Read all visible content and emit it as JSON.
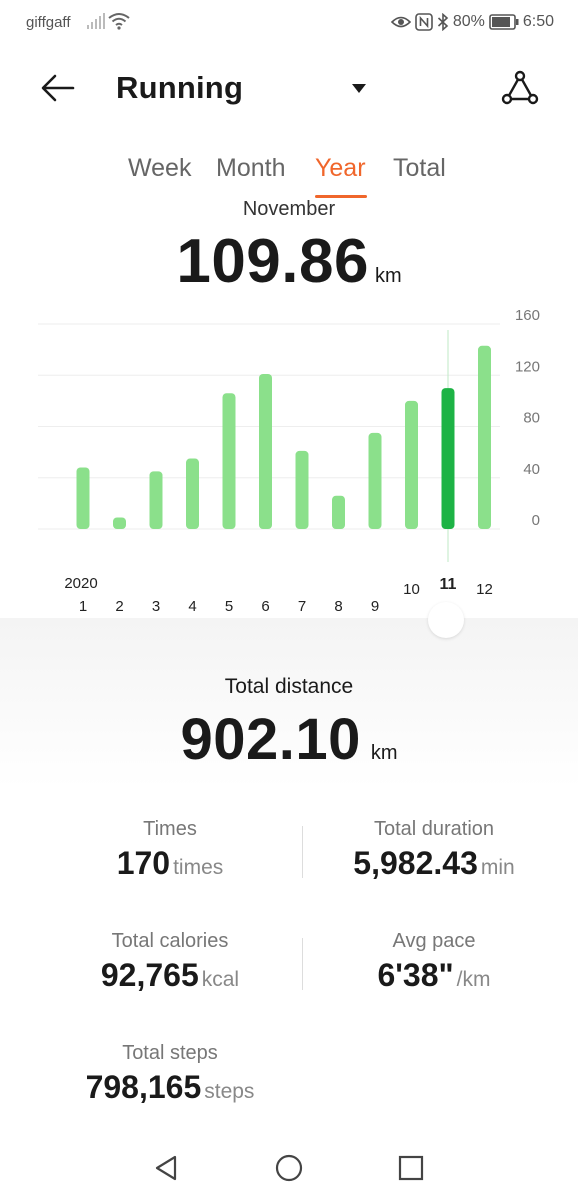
{
  "status_bar": {
    "carrier": "giffgaff",
    "battery": "80%",
    "time": "6:50",
    "icons": [
      "signal-icon",
      "wifi-icon",
      "eye-icon",
      "nfc-icon",
      "bluetooth-icon",
      "battery-icon"
    ]
  },
  "header": {
    "title": "Running",
    "back_icon": "back-arrow-icon",
    "dropdown_icon": "caret-down-icon",
    "action_icon": "route-icon"
  },
  "tabs": [
    {
      "label": "Week",
      "active": false
    },
    {
      "label": "Month",
      "active": false
    },
    {
      "label": "Year",
      "active": true
    },
    {
      "label": "Total",
      "active": false
    }
  ],
  "selected": {
    "month_label": "November",
    "value": "109.86",
    "unit": "km"
  },
  "chart_data": {
    "type": "bar",
    "categories": [
      "1",
      "2",
      "3",
      "4",
      "5",
      "6",
      "7",
      "8",
      "9",
      "10",
      "11",
      "12"
    ],
    "year_label": "2020",
    "values": [
      48,
      9,
      45,
      55,
      106,
      121,
      61,
      26,
      75,
      100,
      110,
      143
    ],
    "y_ticks": [
      "160",
      "120",
      "80",
      "40",
      "0"
    ],
    "ylim": [
      0,
      160
    ],
    "selected_index": 10,
    "colors": {
      "bar": "#8be08b",
      "selected_bar": "#1db345",
      "grid": "#eeeeee",
      "axis_text": "#777777",
      "label_text": "#222222"
    },
    "grid": true
  },
  "summary": {
    "total_label": "Total distance",
    "total_value": "902.10",
    "total_unit": "km",
    "stats": [
      {
        "label": "Times",
        "value": "170",
        "unit": "times"
      },
      {
        "label": "Total duration",
        "value": "5,982.43",
        "unit": "min"
      },
      {
        "label": "Total calories",
        "value": "92,765",
        "unit": "kcal"
      },
      {
        "label": "Avg pace",
        "value": "6'38\"",
        "unit": "/km"
      },
      {
        "label": "Total steps",
        "value": "798,165",
        "unit": "steps"
      }
    ]
  },
  "nav_bar": {
    "icons": [
      "nav-back-icon",
      "nav-home-icon",
      "nav-recents-icon"
    ]
  },
  "colors": {
    "accent": "#f0662b",
    "text": "#1a1a1a",
    "muted": "#777777"
  }
}
